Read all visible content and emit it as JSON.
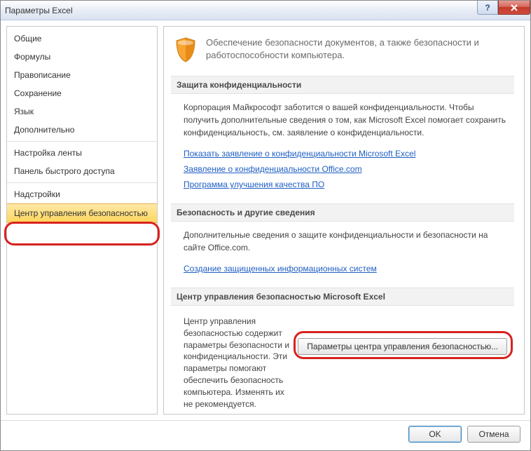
{
  "window": {
    "title": "Параметры Excel"
  },
  "sidebar": {
    "items": [
      {
        "label": "Общие"
      },
      {
        "label": "Формулы"
      },
      {
        "label": "Правописание"
      },
      {
        "label": "Сохранение"
      },
      {
        "label": "Язык"
      },
      {
        "label": "Дополнительно"
      },
      {
        "label": "Настройка ленты"
      },
      {
        "label": "Панель быстрого доступа"
      },
      {
        "label": "Надстройки"
      },
      {
        "label": "Центр управления безопасностью"
      }
    ]
  },
  "hero": {
    "text": "Обеспечение безопасности документов, а также безопасности и работоспособности компьютера."
  },
  "sections": {
    "privacy": {
      "title": "Защита конфиденциальности",
      "body": "Корпорация Майкрософт заботится о вашей конфиденциальности. Чтобы получить дополнительные сведения о том, как Microsoft Excel помогает сохранить конфиденциальность, см. заявление о конфиденциальности.",
      "links": [
        "Показать заявление о конфиденциальности Microsoft Excel",
        "Заявление о конфиденциальности Office.com",
        "Программа улучшения качества ПО"
      ]
    },
    "security_info": {
      "title": "Безопасность и другие сведения",
      "body": "Дополнительные сведения о защите конфиденциальности и безопасности на сайте Office.com.",
      "link": "Создание защищенных информационных систем"
    },
    "trust_center": {
      "title": "Центр управления безопасностью Microsoft Excel",
      "body": "Центр управления безопасностью содержит параметры безопасности и конфиденциальности. Эти параметры помогают обеспечить безопасность компьютера. Изменять их не рекомендуется.",
      "button": "Параметры центра управления безопасностью..."
    }
  },
  "footer": {
    "ok": "OK",
    "cancel": "Отмена"
  }
}
